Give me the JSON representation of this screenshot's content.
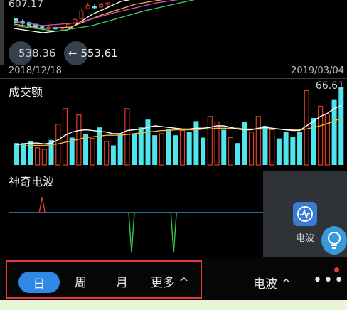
{
  "header": {
    "top_price": "607.17",
    "low_price": "538.36",
    "arrow_label": "← 553.61",
    "date_start": "2018/12/18",
    "date_end": "2019/03/04"
  },
  "volume_panel": {
    "title": "成交额",
    "max_value": "66.61"
  },
  "wave_panel": {
    "title": "神奇电波",
    "app_label": "电波"
  },
  "period_tabs": {
    "day": "日",
    "week": "周",
    "month": "月",
    "more": "更多 ^"
  },
  "toolbar": {
    "wave_dropdown": "电波 ^",
    "more_dots": "•••"
  },
  "colors": {
    "up": "#e23b22",
    "down": "#4ee6ec",
    "ma_white": "#ffffff",
    "ma_yellow": "#f0b43c",
    "accent": "#2f87e8",
    "baseline": "#3b8ed8",
    "signal_green": "#3cc84a",
    "signal_red": "#e23b22"
  },
  "chart_data": {
    "type": "bar",
    "volume_bars": [
      {
        "v": 0.28,
        "up": false
      },
      {
        "v": 0.28,
        "up": false
      },
      {
        "v": 0.3,
        "up": false
      },
      {
        "v": 0.22,
        "up": true
      },
      {
        "v": 0.2,
        "up": true
      },
      {
        "v": 0.32,
        "up": false
      },
      {
        "v": 0.52,
        "up": true
      },
      {
        "v": 0.72,
        "up": true
      },
      {
        "v": 0.35,
        "up": false
      },
      {
        "v": 0.64,
        "up": true
      },
      {
        "v": 0.4,
        "up": false
      },
      {
        "v": 0.34,
        "up": true
      },
      {
        "v": 0.48,
        "up": false
      },
      {
        "v": 0.3,
        "up": true
      },
      {
        "v": 0.25,
        "up": false
      },
      {
        "v": 0.4,
        "up": false
      },
      {
        "v": 0.72,
        "up": true
      },
      {
        "v": 0.4,
        "up": false
      },
      {
        "v": 0.48,
        "up": false
      },
      {
        "v": 0.58,
        "up": false
      },
      {
        "v": 0.38,
        "up": false
      },
      {
        "v": 0.4,
        "up": true
      },
      {
        "v": 0.46,
        "up": false
      },
      {
        "v": 0.38,
        "up": false
      },
      {
        "v": 0.44,
        "up": true
      },
      {
        "v": 0.42,
        "up": false
      },
      {
        "v": 0.56,
        "up": false
      },
      {
        "v": 0.35,
        "up": false
      },
      {
        "v": 0.62,
        "up": true
      },
      {
        "v": 0.55,
        "up": true
      },
      {
        "v": 0.45,
        "up": false
      },
      {
        "v": 0.35,
        "up": true
      },
      {
        "v": 0.28,
        "up": false
      },
      {
        "v": 0.55,
        "up": false
      },
      {
        "v": 0.42,
        "up": true
      },
      {
        "v": 0.62,
        "up": true
      },
      {
        "v": 0.5,
        "up": false
      },
      {
        "v": 0.45,
        "up": true
      },
      {
        "v": 0.34,
        "up": false
      },
      {
        "v": 0.42,
        "up": false
      },
      {
        "v": 0.36,
        "up": false
      },
      {
        "v": 0.42,
        "up": false
      },
      {
        "v": 0.95,
        "up": true
      },
      {
        "v": 0.6,
        "up": false
      },
      {
        "v": 0.75,
        "up": true
      },
      {
        "v": 0.65,
        "up": true
      },
      {
        "v": 0.84,
        "up": false
      },
      {
        "v": 1.0,
        "up": false
      }
    ],
    "ma_white": [
      0.26,
      0.27,
      0.28,
      0.28,
      0.27,
      0.28,
      0.32,
      0.38,
      0.42,
      0.44,
      0.45,
      0.44,
      0.43,
      0.42,
      0.4,
      0.4,
      0.44,
      0.45,
      0.46,
      0.48,
      0.5,
      0.49,
      0.48,
      0.47,
      0.46,
      0.46,
      0.47,
      0.47,
      0.48,
      0.5,
      0.5,
      0.48,
      0.46,
      0.45,
      0.45,
      0.47,
      0.48,
      0.47,
      0.46,
      0.45,
      0.44,
      0.44,
      0.5,
      0.56,
      0.62,
      0.66,
      0.72,
      0.76
    ],
    "ma_yellow": [
      0.24,
      0.24,
      0.25,
      0.25,
      0.25,
      0.26,
      0.27,
      0.29,
      0.31,
      0.33,
      0.35,
      0.36,
      0.37,
      0.38,
      0.38,
      0.38,
      0.39,
      0.4,
      0.41,
      0.42,
      0.43,
      0.44,
      0.44,
      0.45,
      0.45,
      0.45,
      0.45,
      0.46,
      0.46,
      0.47,
      0.47,
      0.47,
      0.47,
      0.46,
      0.46,
      0.46,
      0.46,
      0.46,
      0.46,
      0.45,
      0.45,
      0.45,
      0.46,
      0.48,
      0.5,
      0.53,
      0.56,
      0.6
    ],
    "wave_signals": [
      {
        "x": 0.16,
        "dir": "up",
        "color": "red",
        "depth": 0.7
      },
      {
        "x": 0.5,
        "dir": "down",
        "color": "green",
        "depth": 0.95
      },
      {
        "x": 0.66,
        "dir": "down",
        "color": "green",
        "depth": 0.95
      }
    ],
    "candles": [
      {
        "o": 0.62,
        "c": 0.52,
        "h": 0.66,
        "l": 0.48,
        "up": false
      },
      {
        "o": 0.56,
        "c": 0.5,
        "h": 0.6,
        "l": 0.46,
        "up": false
      },
      {
        "o": 0.52,
        "c": 0.46,
        "h": 0.54,
        "l": 0.44,
        "up": false
      },
      {
        "o": 0.48,
        "c": 0.42,
        "h": 0.5,
        "l": 0.4,
        "up": false
      },
      {
        "o": 0.42,
        "c": 0.38,
        "h": 0.45,
        "l": 0.34,
        "up": false
      },
      {
        "o": 0.37,
        "c": 0.41,
        "h": 0.43,
        "l": 0.35,
        "up": true
      },
      {
        "o": 0.4,
        "c": 0.37,
        "h": 0.43,
        "l": 0.35,
        "up": false
      },
      {
        "o": 0.37,
        "c": 0.4,
        "h": 0.42,
        "l": 0.34,
        "up": true
      },
      {
        "o": 0.4,
        "c": 0.48,
        "h": 0.5,
        "l": 0.38,
        "up": true
      },
      {
        "o": 0.5,
        "c": 0.6,
        "h": 0.64,
        "l": 0.48,
        "up": true
      },
      {
        "o": 0.62,
        "c": 0.8,
        "h": 0.84,
        "l": 0.6,
        "up": true
      },
      {
        "o": 0.86,
        "c": 0.94,
        "h": 1.0,
        "l": 0.84,
        "up": true
      },
      {
        "o": 0.92,
        "c": 0.88,
        "h": 0.98,
        "l": 0.86,
        "up": false
      },
      {
        "o": 0.9,
        "c": 0.96,
        "h": 1.0,
        "l": 0.88,
        "up": true
      },
      {
        "o": 0.98,
        "c": 1.0,
        "h": 1.0,
        "l": 0.94,
        "up": true
      }
    ]
  }
}
